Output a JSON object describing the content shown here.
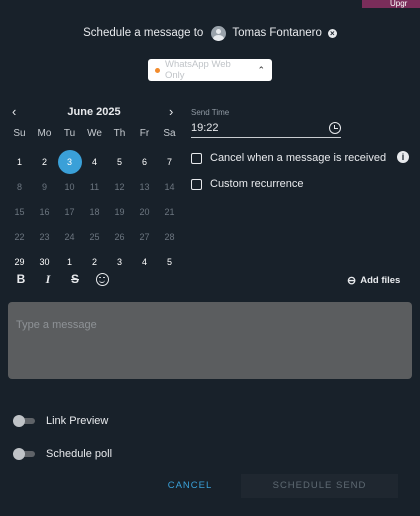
{
  "top_badge": "Upgr",
  "header": {
    "prefix": "Schedule a message to",
    "recipient_name": "Tomas Fontanero"
  },
  "mode": {
    "label": "WhatsApp Web Only",
    "dot_color": "#f28b2c"
  },
  "calendar": {
    "month_label": "June 2025",
    "weekdays": [
      "Su",
      "Mo",
      "Tu",
      "We",
      "Th",
      "Fr",
      "Sa"
    ],
    "weeks": [
      [
        "1",
        "2",
        "3",
        "4",
        "5",
        "6",
        "7"
      ],
      [
        "8",
        "9",
        "10",
        "11",
        "12",
        "13",
        "14"
      ],
      [
        "15",
        "16",
        "17",
        "18",
        "19",
        "20",
        "21"
      ],
      [
        "22",
        "23",
        "24",
        "25",
        "26",
        "27",
        "28"
      ],
      [
        "29",
        "30",
        "1",
        "2",
        "3",
        "4",
        "5"
      ]
    ],
    "selected_day": "3",
    "accent_color": "#3aa0d8"
  },
  "send_time": {
    "label": "Send Time",
    "value": "19:22"
  },
  "options": {
    "cancel_on_receive": "Cancel when a message is received",
    "custom_recurrence": "Custom recurrence"
  },
  "toolbar": {
    "bold": "B",
    "italic": "I",
    "strike": "S",
    "add_files": "Add files"
  },
  "message": {
    "placeholder": "Type a message"
  },
  "toggles": {
    "link_preview": "Link Preview",
    "schedule_poll": "Schedule poll"
  },
  "actions": {
    "cancel": "CANCEL",
    "schedule_send": "SCHEDULE SEND"
  }
}
